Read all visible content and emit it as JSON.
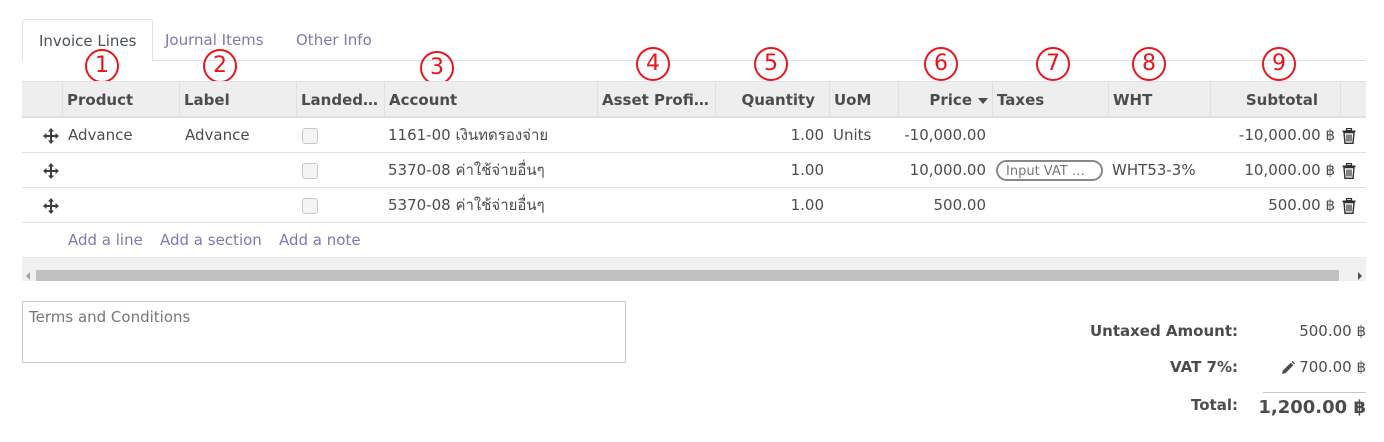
{
  "tabs": [
    {
      "label": "Invoice Lines",
      "active": true
    },
    {
      "label": "Journal Items",
      "active": false
    },
    {
      "label": "Other Info",
      "active": false
    }
  ],
  "badges": [
    "1",
    "2",
    "3",
    "4",
    "5",
    "6",
    "7",
    "8",
    "9"
  ],
  "columns": {
    "product": "Product",
    "label": "Label",
    "landed": "Landed…",
    "account": "Account",
    "asset_profile": "Asset Profi…",
    "quantity": "Quantity",
    "uom": "UoM",
    "price": "Price",
    "taxes": "Taxes",
    "wht": "WHT",
    "subtotal": "Subtotal"
  },
  "rows": [
    {
      "product": "Advance",
      "label": "Advance",
      "landed": false,
      "account": "1161-00 เงินทดรองจ่าย",
      "asset_profile": "",
      "quantity": "1.00",
      "uom": "Units",
      "price": "-10,000.00",
      "taxes": "",
      "wht": "",
      "subtotal": "-10,000.00 ฿"
    },
    {
      "product": "",
      "label": "",
      "landed": false,
      "account": "5370-08 ค่าใช้จ่ายอื่นๆ",
      "asset_profile": "",
      "quantity": "1.00",
      "uom": "",
      "price": "10,000.00",
      "taxes": "Input VAT …",
      "wht": "WHT53-3%",
      "subtotal": "10,000.00 ฿"
    },
    {
      "product": "",
      "label": "",
      "landed": false,
      "account": "5370-08 ค่าใช้จ่ายอื่นๆ",
      "asset_profile": "",
      "quantity": "1.00",
      "uom": "",
      "price": "500.00",
      "taxes": "",
      "wht": "",
      "subtotal": "500.00 ฿"
    }
  ],
  "add_links": {
    "line": "Add a line",
    "section": "Add a section",
    "note": "Add a note"
  },
  "terms_placeholder": "Terms and Conditions",
  "totals": {
    "untaxed_label": "Untaxed Amount:",
    "untaxed_value": "500.00 ฿",
    "vat_label": "VAT 7%:",
    "vat_value": "700.00 ฿",
    "total_label": "Total:",
    "total_value": "1,200.00 ฿"
  },
  "colors": {
    "badge": "#e8161b",
    "link": "#7c7bad",
    "header_bg": "#eeeeee"
  },
  "icons": [
    "move-handle-icon",
    "trash-icon",
    "pencil-icon",
    "sort-caret-icon"
  ]
}
